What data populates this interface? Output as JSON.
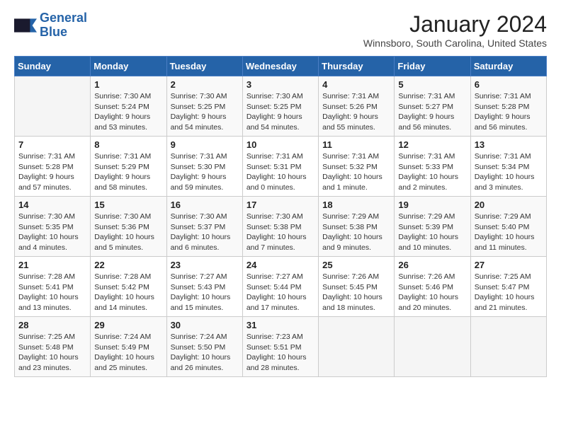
{
  "logo": {
    "line1": "General",
    "line2": "Blue"
  },
  "title": "January 2024",
  "location": "Winnsboro, South Carolina, United States",
  "weekdays": [
    "Sunday",
    "Monday",
    "Tuesday",
    "Wednesday",
    "Thursday",
    "Friday",
    "Saturday"
  ],
  "weeks": [
    [
      {
        "num": "",
        "info": ""
      },
      {
        "num": "1",
        "info": "Sunrise: 7:30 AM\nSunset: 5:24 PM\nDaylight: 9 hours\nand 53 minutes."
      },
      {
        "num": "2",
        "info": "Sunrise: 7:30 AM\nSunset: 5:25 PM\nDaylight: 9 hours\nand 54 minutes."
      },
      {
        "num": "3",
        "info": "Sunrise: 7:30 AM\nSunset: 5:25 PM\nDaylight: 9 hours\nand 54 minutes."
      },
      {
        "num": "4",
        "info": "Sunrise: 7:31 AM\nSunset: 5:26 PM\nDaylight: 9 hours\nand 55 minutes."
      },
      {
        "num": "5",
        "info": "Sunrise: 7:31 AM\nSunset: 5:27 PM\nDaylight: 9 hours\nand 56 minutes."
      },
      {
        "num": "6",
        "info": "Sunrise: 7:31 AM\nSunset: 5:28 PM\nDaylight: 9 hours\nand 56 minutes."
      }
    ],
    [
      {
        "num": "7",
        "info": "Sunrise: 7:31 AM\nSunset: 5:28 PM\nDaylight: 9 hours\nand 57 minutes."
      },
      {
        "num": "8",
        "info": "Sunrise: 7:31 AM\nSunset: 5:29 PM\nDaylight: 9 hours\nand 58 minutes."
      },
      {
        "num": "9",
        "info": "Sunrise: 7:31 AM\nSunset: 5:30 PM\nDaylight: 9 hours\nand 59 minutes."
      },
      {
        "num": "10",
        "info": "Sunrise: 7:31 AM\nSunset: 5:31 PM\nDaylight: 10 hours\nand 0 minutes."
      },
      {
        "num": "11",
        "info": "Sunrise: 7:31 AM\nSunset: 5:32 PM\nDaylight: 10 hours\nand 1 minute."
      },
      {
        "num": "12",
        "info": "Sunrise: 7:31 AM\nSunset: 5:33 PM\nDaylight: 10 hours\nand 2 minutes."
      },
      {
        "num": "13",
        "info": "Sunrise: 7:31 AM\nSunset: 5:34 PM\nDaylight: 10 hours\nand 3 minutes."
      }
    ],
    [
      {
        "num": "14",
        "info": "Sunrise: 7:30 AM\nSunset: 5:35 PM\nDaylight: 10 hours\nand 4 minutes."
      },
      {
        "num": "15",
        "info": "Sunrise: 7:30 AM\nSunset: 5:36 PM\nDaylight: 10 hours\nand 5 minutes."
      },
      {
        "num": "16",
        "info": "Sunrise: 7:30 AM\nSunset: 5:37 PM\nDaylight: 10 hours\nand 6 minutes."
      },
      {
        "num": "17",
        "info": "Sunrise: 7:30 AM\nSunset: 5:38 PM\nDaylight: 10 hours\nand 7 minutes."
      },
      {
        "num": "18",
        "info": "Sunrise: 7:29 AM\nSunset: 5:38 PM\nDaylight: 10 hours\nand 9 minutes."
      },
      {
        "num": "19",
        "info": "Sunrise: 7:29 AM\nSunset: 5:39 PM\nDaylight: 10 hours\nand 10 minutes."
      },
      {
        "num": "20",
        "info": "Sunrise: 7:29 AM\nSunset: 5:40 PM\nDaylight: 10 hours\nand 11 minutes."
      }
    ],
    [
      {
        "num": "21",
        "info": "Sunrise: 7:28 AM\nSunset: 5:41 PM\nDaylight: 10 hours\nand 13 minutes."
      },
      {
        "num": "22",
        "info": "Sunrise: 7:28 AM\nSunset: 5:42 PM\nDaylight: 10 hours\nand 14 minutes."
      },
      {
        "num": "23",
        "info": "Sunrise: 7:27 AM\nSunset: 5:43 PM\nDaylight: 10 hours\nand 15 minutes."
      },
      {
        "num": "24",
        "info": "Sunrise: 7:27 AM\nSunset: 5:44 PM\nDaylight: 10 hours\nand 17 minutes."
      },
      {
        "num": "25",
        "info": "Sunrise: 7:26 AM\nSunset: 5:45 PM\nDaylight: 10 hours\nand 18 minutes."
      },
      {
        "num": "26",
        "info": "Sunrise: 7:26 AM\nSunset: 5:46 PM\nDaylight: 10 hours\nand 20 minutes."
      },
      {
        "num": "27",
        "info": "Sunrise: 7:25 AM\nSunset: 5:47 PM\nDaylight: 10 hours\nand 21 minutes."
      }
    ],
    [
      {
        "num": "28",
        "info": "Sunrise: 7:25 AM\nSunset: 5:48 PM\nDaylight: 10 hours\nand 23 minutes."
      },
      {
        "num": "29",
        "info": "Sunrise: 7:24 AM\nSunset: 5:49 PM\nDaylight: 10 hours\nand 25 minutes."
      },
      {
        "num": "30",
        "info": "Sunrise: 7:24 AM\nSunset: 5:50 PM\nDaylight: 10 hours\nand 26 minutes."
      },
      {
        "num": "31",
        "info": "Sunrise: 7:23 AM\nSunset: 5:51 PM\nDaylight: 10 hours\nand 28 minutes."
      },
      {
        "num": "",
        "info": ""
      },
      {
        "num": "",
        "info": ""
      },
      {
        "num": "",
        "info": ""
      }
    ]
  ]
}
